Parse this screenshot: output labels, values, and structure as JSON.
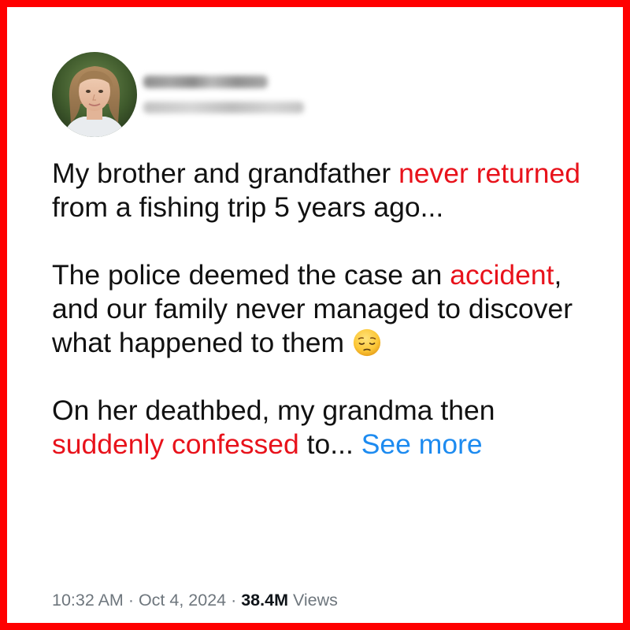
{
  "author": {
    "avatar_icon": "profile-photo-avatar",
    "display_name": "",
    "handle": ""
  },
  "post": {
    "p1": {
      "a": "My brother and grandfather ",
      "b": "never returned",
      "c": " from a fishing trip 5 years ago..."
    },
    "p2": {
      "a": "The police deemed the case an ",
      "b": "accident",
      "c": ", and our family never managed to discover what happened to them",
      "emoji_icon": "pensive-face-emoji"
    },
    "p3": {
      "a": "On her deathbed, my grandma then ",
      "b": "suddenly confessed",
      "c": " to... ",
      "see_more": "See more"
    }
  },
  "meta": {
    "time": "10:32 AM",
    "sep1": " · ",
    "date": "Oct 4, 2024",
    "sep2": " · ",
    "views_count": "38.4M",
    "views_label": " Views"
  },
  "colors": {
    "frame_border": "#ff0000",
    "highlight_red": "#e8121b",
    "link_blue": "#1d8bf0",
    "meta_gray": "#6e767d"
  }
}
